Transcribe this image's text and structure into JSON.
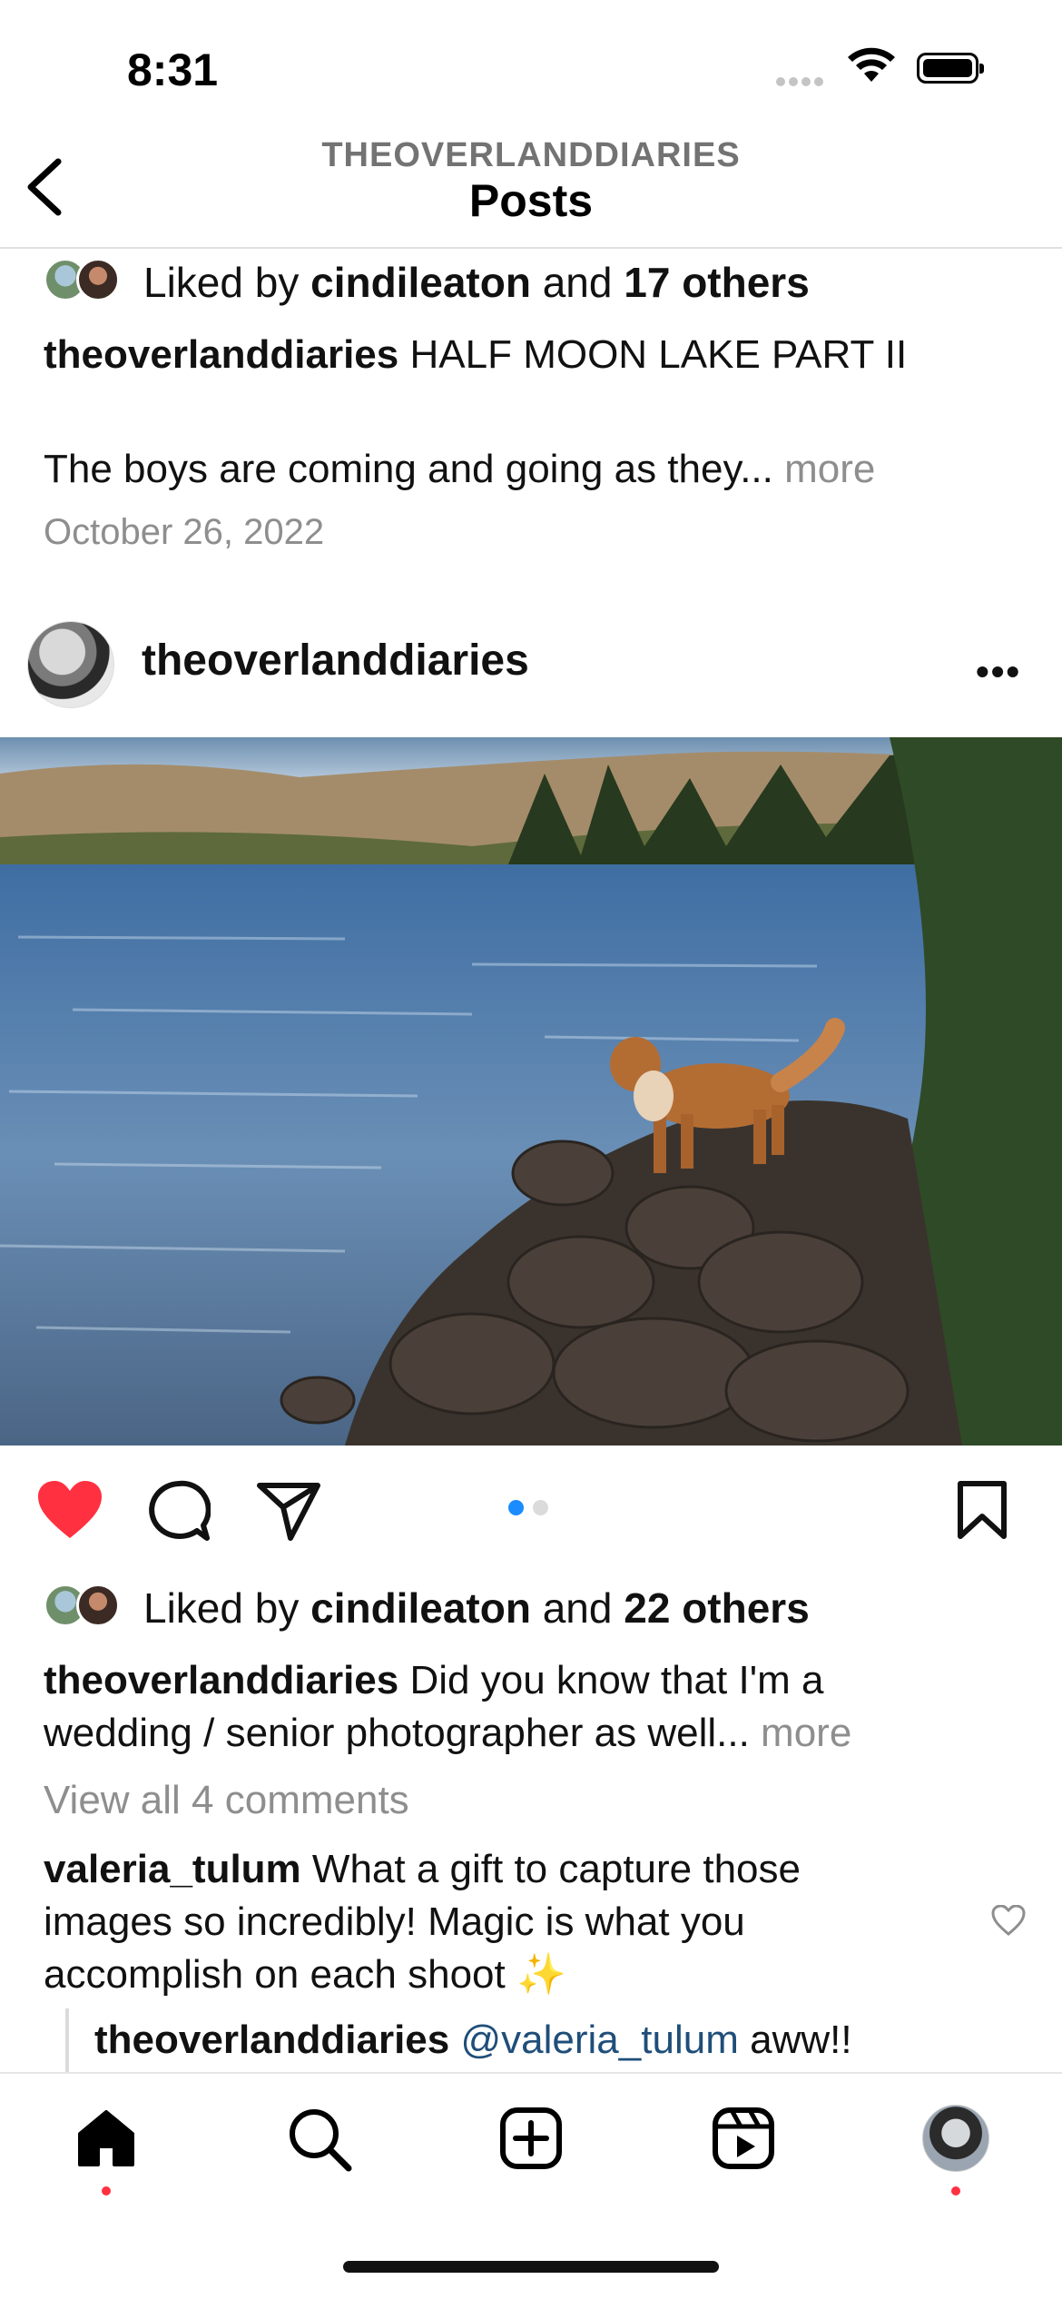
{
  "status_bar": {
    "time": "8:31"
  },
  "nav": {
    "subtitle": "THEOVERLANDDIARIES",
    "title": "Posts"
  },
  "prev_post": {
    "likes_prefix": "Liked by ",
    "liker": "cindileaton",
    "likes_mid": " and ",
    "others": "17 others",
    "caption_user": "theoverlanddiaries",
    "caption_line1": "HALF MOON LAKE PART II",
    "caption_line2": "The boys are coming and going as they...",
    "more": "more",
    "date": "October 26, 2022"
  },
  "post": {
    "username": "theoverlanddiaries",
    "more_label": "•••",
    "carousel": {
      "active_color": "#1a8cff",
      "inactive_color": "#dbdbdb"
    },
    "liked": true,
    "like_color": "#ff3040",
    "likes_prefix": "Liked by ",
    "liker": "cindileaton",
    "likes_mid": " and ",
    "others": "22 others",
    "caption_user": "theoverlanddiaries",
    "caption_text1": "Did you know that I'm a",
    "caption_text2": "wedding / senior photographer as well...",
    "more": "more",
    "view_comments": "View all 4 comments",
    "comment": {
      "user": "valeria_tulum",
      "text1": "What a gift to capture those",
      "text2": "images so incredibly! Magic is what you",
      "text3": "accomplish on each shoot ✨"
    },
    "reply": {
      "user": "theoverlanddiaries",
      "mention": "@valeria_tulum",
      "text": "aww!!"
    }
  },
  "tabbar": {
    "items": [
      "home",
      "search",
      "create",
      "reels",
      "profile"
    ],
    "badge_color": "#ff3040"
  }
}
